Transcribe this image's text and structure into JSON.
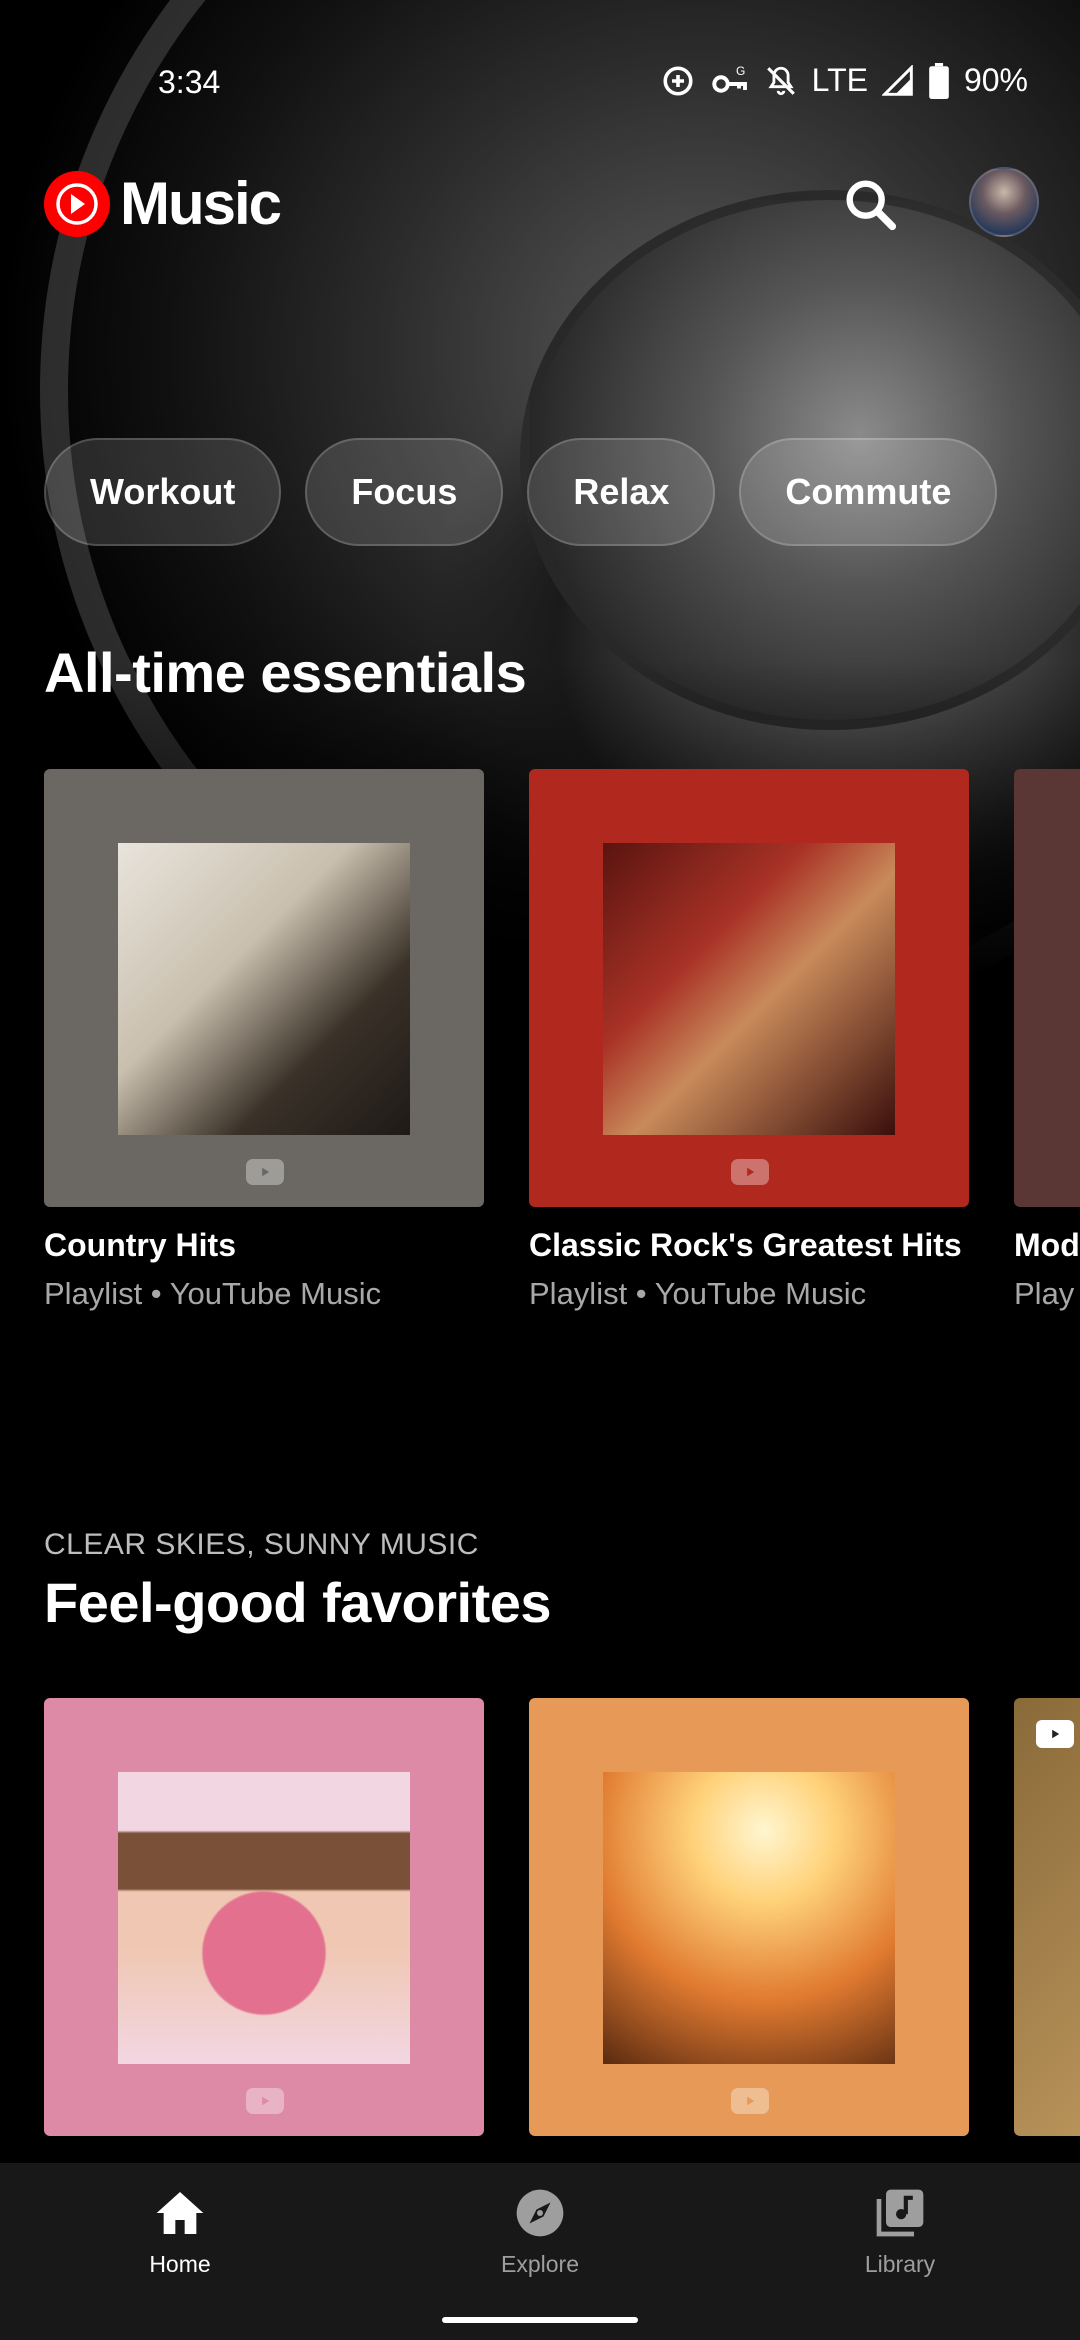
{
  "status_bar": {
    "time": "3:34",
    "network": "LTE",
    "battery": "90%",
    "icons": [
      "data-saver-icon",
      "vpn-key-icon",
      "notifications-off-icon",
      "signal-icon",
      "battery-icon"
    ]
  },
  "header": {
    "app_name": "Music",
    "search_icon": "search-icon",
    "avatar": "account-avatar"
  },
  "chips": [
    {
      "label": "Workout"
    },
    {
      "label": "Focus"
    },
    {
      "label": "Relax"
    },
    {
      "label": "Commute"
    }
  ],
  "sections": [
    {
      "kicker": "",
      "title": "All-time essentials",
      "cards": [
        {
          "title": "Country Hits",
          "subtitle": "Playlist • YouTube Music",
          "bg": "#6b6763"
        },
        {
          "title": "Classic Rock's Greatest Hits",
          "subtitle": "Playlist • YouTube Music",
          "bg": "#b0281e"
        },
        {
          "title": "Mod",
          "subtitle": "Play",
          "bg": "#5a3634"
        }
      ]
    },
    {
      "kicker": "CLEAR SKIES, SUNNY MUSIC",
      "title": "Feel-good favorites",
      "cards": [
        {
          "title": "",
          "subtitle": "",
          "bg": "#dc8aa6"
        },
        {
          "title": "",
          "subtitle": "",
          "bg": "#e79a58"
        },
        {
          "title": "",
          "subtitle": "",
          "bg": "#8a6a3a"
        }
      ]
    }
  ],
  "bottom_nav": [
    {
      "label": "Home",
      "icon": "home-icon",
      "active": true
    },
    {
      "label": "Explore",
      "icon": "explore-icon",
      "active": false
    },
    {
      "label": "Library",
      "icon": "library-icon",
      "active": false
    }
  ],
  "colors": {
    "brand": "#ff0000",
    "background": "#000000",
    "nav_bg": "#181818",
    "muted_text": "#a8a8a8"
  }
}
